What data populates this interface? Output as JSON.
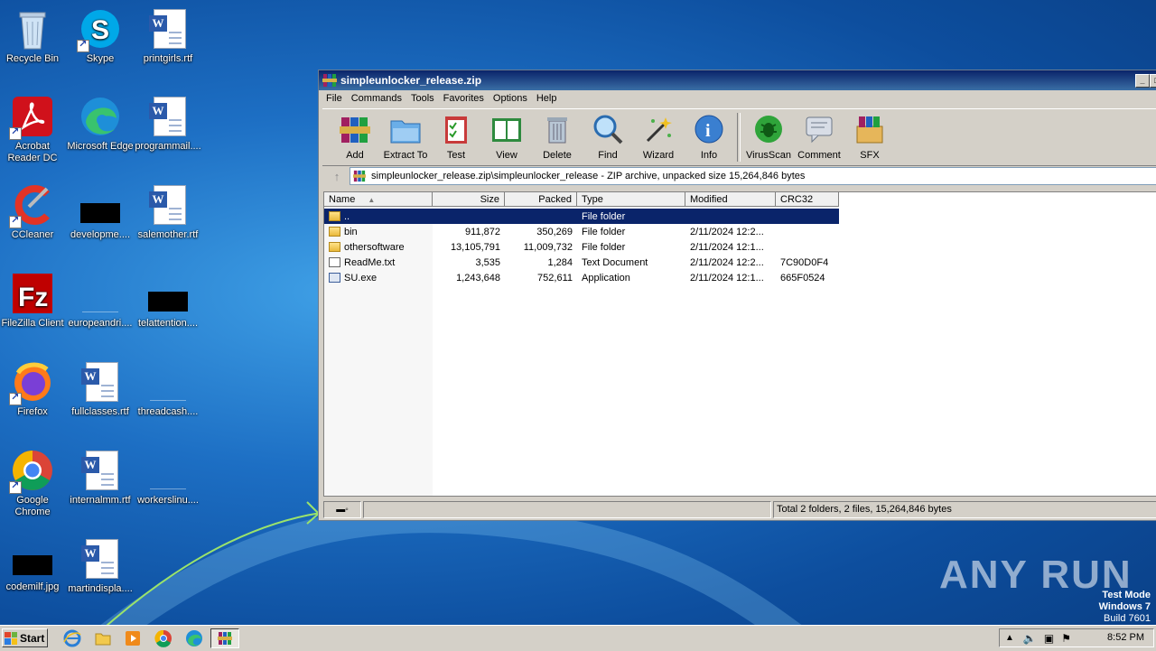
{
  "desktop": {
    "icons": [
      {
        "label": "Recycle Bin",
        "icon": "recycle-bin-icon"
      },
      {
        "label": "Skype",
        "icon": "skype-icon"
      },
      {
        "label": "printgirls.rtf",
        "icon": "word-doc-icon"
      },
      {
        "label": "Acrobat\nReader DC",
        "icon": "acrobat-icon"
      },
      {
        "label": "Microsoft Edge",
        "icon": "edge-icon"
      },
      {
        "label": "programmail....",
        "icon": "word-doc-icon"
      },
      {
        "label": "CCleaner",
        "icon": "ccleaner-icon"
      },
      {
        "label": "developme....",
        "icon": "image-file-icon"
      },
      {
        "label": "salemother.rtf",
        "icon": "word-doc-icon"
      },
      {
        "label": "FileZilla Client",
        "icon": "filezilla-icon"
      },
      {
        "label": "europeandri....",
        "icon": "blank-file-icon"
      },
      {
        "label": "telattention....",
        "icon": "image-file-icon"
      },
      {
        "label": "Firefox",
        "icon": "firefox-icon"
      },
      {
        "label": "fullclasses.rtf",
        "icon": "word-doc-icon"
      },
      {
        "label": "threadcash....",
        "icon": "blank-file-icon"
      },
      {
        "label": "Google\nChrome",
        "icon": "chrome-icon"
      },
      {
        "label": "internalmm.rtf",
        "icon": "word-doc-icon"
      },
      {
        "label": "workerslinu....",
        "icon": "blank-file-icon"
      },
      {
        "label": "codemilf.jpg",
        "icon": "image-file-icon"
      },
      {
        "label": "martindispla....",
        "icon": "word-doc-icon"
      }
    ]
  },
  "window": {
    "title": "simpleunlocker_release.zip",
    "menu": [
      "File",
      "Commands",
      "Tools",
      "Favorites",
      "Options",
      "Help"
    ],
    "toolbar": [
      "Add",
      "Extract To",
      "Test",
      "View",
      "Delete",
      "Find",
      "Wizard",
      "Info",
      "VirusScan",
      "Comment",
      "SFX"
    ],
    "address": "simpleunlocker_release.zip\\simpleunlocker_release - ZIP archive, unpacked size 15,264,846 bytes",
    "columns": [
      "Name",
      "Size",
      "Packed",
      "Type",
      "Modified",
      "CRC32"
    ],
    "rows": [
      {
        "name": "..",
        "size": "",
        "packed": "",
        "type": "File folder",
        "modified": "",
        "crc": "",
        "icon": "folder-up-icon"
      },
      {
        "name": "bin",
        "size": "911,872",
        "packed": "350,269",
        "type": "File folder",
        "modified": "2/11/2024 12:2...",
        "crc": "",
        "icon": "folder-icon"
      },
      {
        "name": "othersoftware",
        "size": "13,105,791",
        "packed": "11,009,732",
        "type": "File folder",
        "modified": "2/11/2024 12:1...",
        "crc": "",
        "icon": "folder-icon"
      },
      {
        "name": "ReadMe.txt",
        "size": "3,535",
        "packed": "1,284",
        "type": "Text Document",
        "modified": "2/11/2024 12:2...",
        "crc": "7C90D0F4",
        "icon": "text-file-icon"
      },
      {
        "name": "SU.exe",
        "size": "1,243,648",
        "packed": "752,611",
        "type": "Application",
        "modified": "2/11/2024 12:1...",
        "crc": "665F0524",
        "icon": "exe-file-icon"
      }
    ],
    "status": "Total 2 folders, 2 files, 15,264,846 bytes"
  },
  "taskbar": {
    "start": "Start",
    "clock": "8:52 PM"
  },
  "watermark": {
    "brand": "ANY RUN",
    "line1": "Test Mode",
    "line2": "Windows 7",
    "line3": "Build 7601"
  }
}
